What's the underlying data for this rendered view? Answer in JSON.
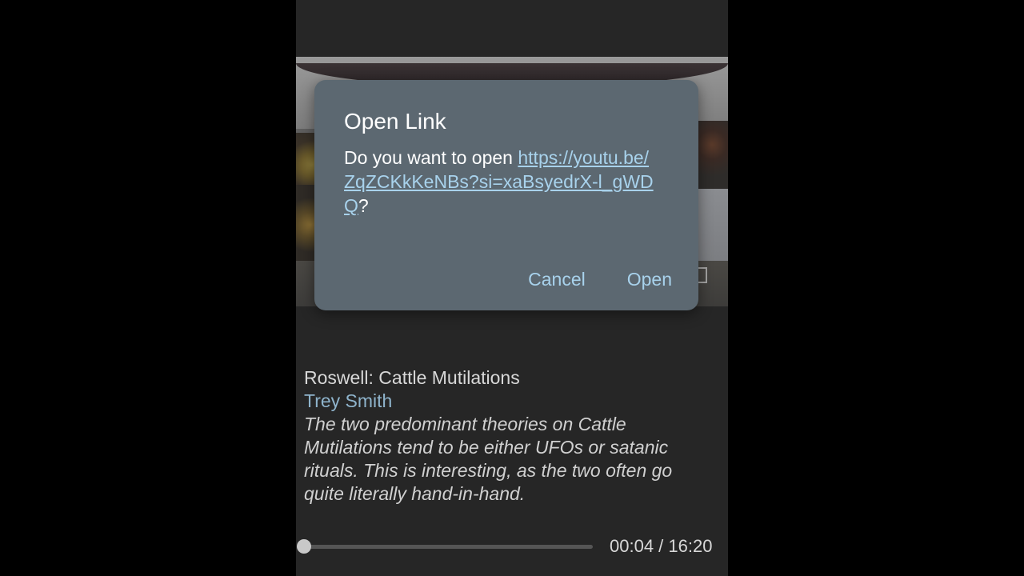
{
  "dialog": {
    "title": "Open Link",
    "body_prefix": "Do you want to open ",
    "link": "https://youtu.be/ZqZCKkKeNBs?si=xaBsyedrX-l_gWDQ",
    "body_suffix": "?",
    "cancel_label": "Cancel",
    "open_label": "Open"
  },
  "video": {
    "title": "Roswell: Cattle Mutilations",
    "author": "Trey Smith",
    "description": "The two predominant theories on Cattle Mutilations tend to be either UFOs or satanic rituals. This is interesting, as the two often go quite literally hand-in-hand."
  },
  "player": {
    "time_label": "00:04 / 16:20",
    "progress_fraction": 0.004
  },
  "colors": {
    "dialog_bg": "#5c6871",
    "accent": "#a8d2ec",
    "author": "#8fb4cc"
  }
}
